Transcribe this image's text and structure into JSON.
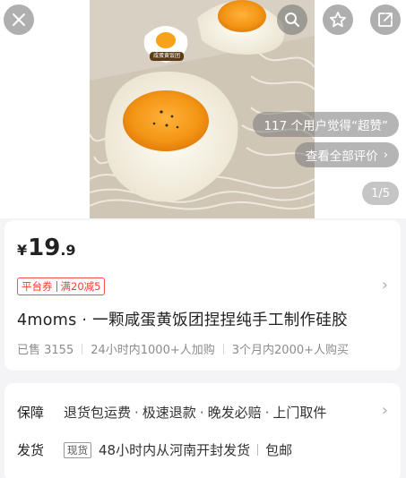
{
  "toolbar": {
    "close_icon": "close-icon",
    "search_icon": "search-icon",
    "favorite_icon": "star-icon",
    "share_icon": "share-icon"
  },
  "gallery": {
    "sticker_text": "咸蛋黄饭团",
    "praise_text": "117 个用户觉得“超赞”",
    "reviews_label": "查看全部评价",
    "reviews_chevron": "›",
    "pager": "1/5"
  },
  "price": {
    "currency": "¥",
    "integer": "19",
    "decimal": ".9"
  },
  "coupon": {
    "tag": "平台券",
    "rule": "满20减5",
    "arrow": "›"
  },
  "product": {
    "title": "4moms · 一颗咸蛋黄饭团捏捏纯手工制作硅胶"
  },
  "stats": {
    "sold": "已售 3155",
    "day": "24小时内1000+人加购",
    "month": "3个月内2000+人购买"
  },
  "service": {
    "guarantee_label": "保障",
    "items": [
      "退货包运费",
      "极速退款",
      "晚发必赔",
      "上门取件"
    ],
    "separator": "·",
    "arrow": "›",
    "ship_label": "发货",
    "stock_tag": "现货",
    "ship_text": "48小时内从河南开封发货",
    "ship_extra": "包邮"
  },
  "colors": {
    "accent_red": "#ff3b30",
    "egg_yolk": "#f7a21b",
    "background": "#f4f4f6"
  }
}
